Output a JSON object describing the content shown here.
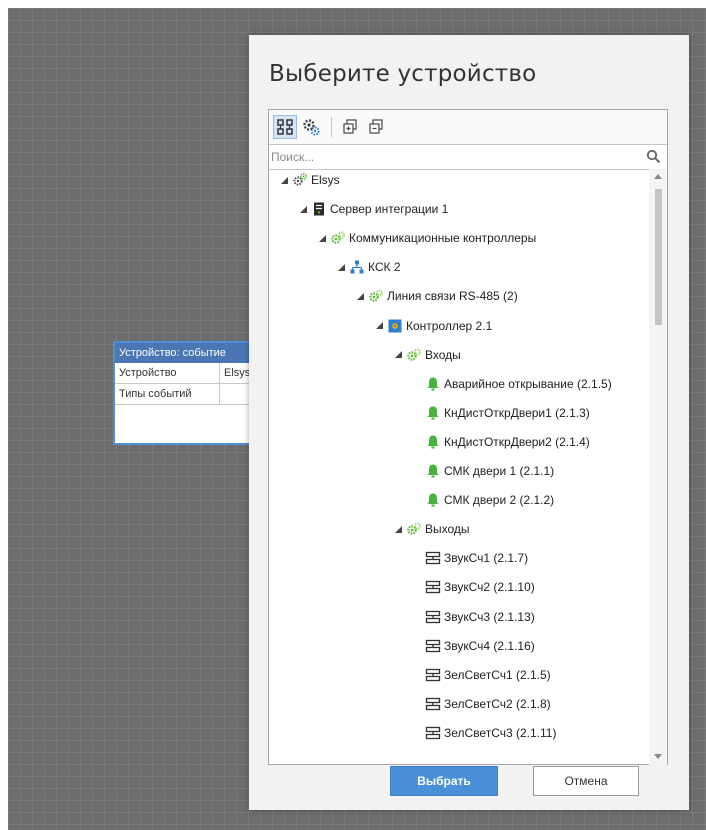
{
  "background": {
    "node_card": {
      "title": "Устройство: событие",
      "rows": [
        {
          "key": "Устройство",
          "value": "Elsys"
        },
        {
          "key": "Типы событий",
          "value": ""
        }
      ]
    }
  },
  "dialog": {
    "title": "Выберите устройство",
    "search_placeholder": "Поиск...",
    "toolbar": [
      {
        "name": "hierarchy-view-icon",
        "active": true
      },
      {
        "name": "settings-view-icon",
        "active": false
      },
      {
        "name": "expand-all-icon",
        "active": false
      },
      {
        "name": "collapse-all-icon",
        "active": false
      }
    ],
    "tree": [
      {
        "label": "Elsys",
        "level": 0,
        "icon": "gears-icon",
        "expanded": true
      },
      {
        "label": "Сервер интеграции 1",
        "level": 1,
        "icon": "server-icon",
        "expanded": true
      },
      {
        "label": "Коммуникационные контроллеры",
        "level": 2,
        "icon": "gear-green-icon",
        "expanded": true
      },
      {
        "label": "КСК 2",
        "level": 3,
        "icon": "network-icon",
        "expanded": true
      },
      {
        "label": "Линия связи RS-485 (2)",
        "level": 4,
        "icon": "gear-green-icon",
        "expanded": true
      },
      {
        "label": "Контроллер 2.1",
        "level": 5,
        "icon": "controller-icon",
        "expanded": true
      },
      {
        "label": "Входы",
        "level": 6,
        "icon": "gear-green-icon",
        "expanded": true
      },
      {
        "label": "Аварийное открывание (2.1.5)",
        "level": 7,
        "icon": "bell-icon",
        "expanded": null
      },
      {
        "label": "КнДистОткрДвери1 (2.1.3)",
        "level": 7,
        "icon": "bell-icon",
        "expanded": null
      },
      {
        "label": "КнДистОткрДвери2 (2.1.4)",
        "level": 7,
        "icon": "bell-icon",
        "expanded": null
      },
      {
        "label": "СМК двери 1 (2.1.1)",
        "level": 7,
        "icon": "bell-icon",
        "expanded": null
      },
      {
        "label": "СМК двери 2 (2.1.2)",
        "level": 7,
        "icon": "bell-icon",
        "expanded": null
      },
      {
        "label": "Выходы",
        "level": 6,
        "icon": "gear-green-icon",
        "expanded": true
      },
      {
        "label": "ЗвукСч1 (2.1.7)",
        "level": 7,
        "icon": "output-icon",
        "expanded": null
      },
      {
        "label": "ЗвукСч2 (2.1.10)",
        "level": 7,
        "icon": "output-icon",
        "expanded": null
      },
      {
        "label": "ЗвукСч3 (2.1.13)",
        "level": 7,
        "icon": "output-icon",
        "expanded": null
      },
      {
        "label": "ЗвукСч4 (2.1.16)",
        "level": 7,
        "icon": "output-icon",
        "expanded": null
      },
      {
        "label": "ЗелСветСч1 (2.1.5)",
        "level": 7,
        "icon": "output-icon",
        "expanded": null
      },
      {
        "label": "ЗелСветСч2 (2.1.8)",
        "level": 7,
        "icon": "output-icon",
        "expanded": null
      },
      {
        "label": "ЗелСветСч3 (2.1.11)",
        "level": 7,
        "icon": "output-icon",
        "expanded": null
      }
    ],
    "ok_label": "Выбрать",
    "cancel_label": "Отмена"
  },
  "colors": {
    "accent": "#4a90d9",
    "tree_green": "#5cb82e",
    "node_header": "#4a77b4"
  }
}
